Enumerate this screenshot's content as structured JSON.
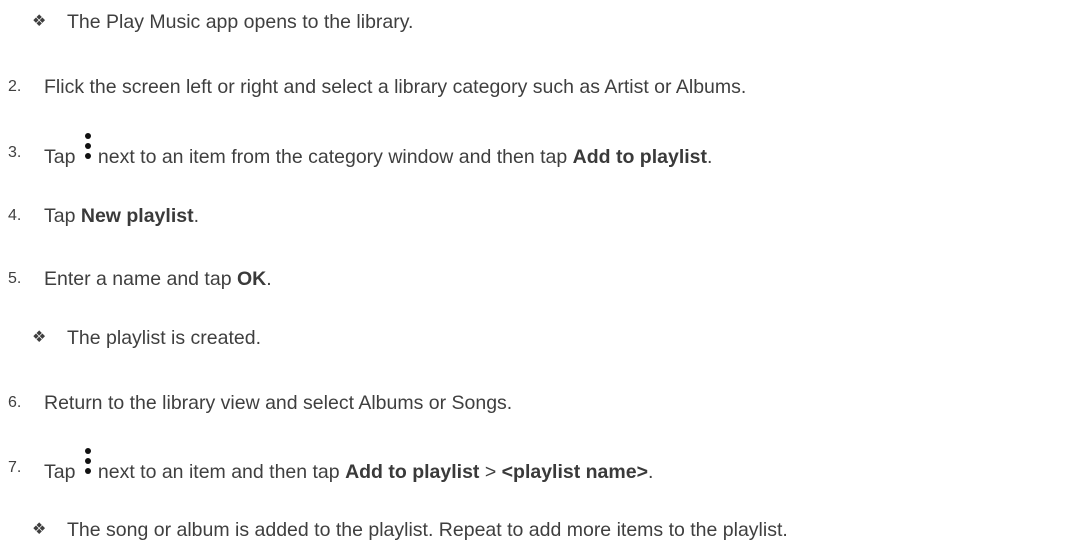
{
  "bullet_glyph": "❖",
  "lines": [
    {
      "type": "sub",
      "text": "The Play Music app opens to the library."
    },
    {
      "type": "step",
      "num": "2.",
      "text": "Flick the screen left or right and select a library category such as Artist or Albums."
    },
    {
      "type": "step",
      "num": "3.",
      "pre": "Tap",
      "icon": "more-vert-icon",
      "mid": "next to an item from the category window and then tap",
      "bold": "Add to playlist",
      "post": "."
    },
    {
      "type": "step",
      "num": "4.",
      "pre": "Tap",
      "bold": "New playlist",
      "post": "."
    },
    {
      "type": "step",
      "num": "5.",
      "pre": "Enter a name and tap",
      "bold": "OK",
      "post": "."
    },
    {
      "type": "sub",
      "text": "The playlist is created."
    },
    {
      "type": "step",
      "num": "6.",
      "text": "Return to the library view and select Albums or Songs."
    },
    {
      "type": "step",
      "num": "7.",
      "pre": "Tap",
      "icon": "more-vert-icon",
      "mid": "next to an item and then tap",
      "bold": "Add to playlist",
      "sep": ">",
      "bold2": "<playlist name>",
      "post": "."
    },
    {
      "type": "sub",
      "text": "The song or album is added to the playlist. Repeat to add more items to the playlist."
    }
  ]
}
